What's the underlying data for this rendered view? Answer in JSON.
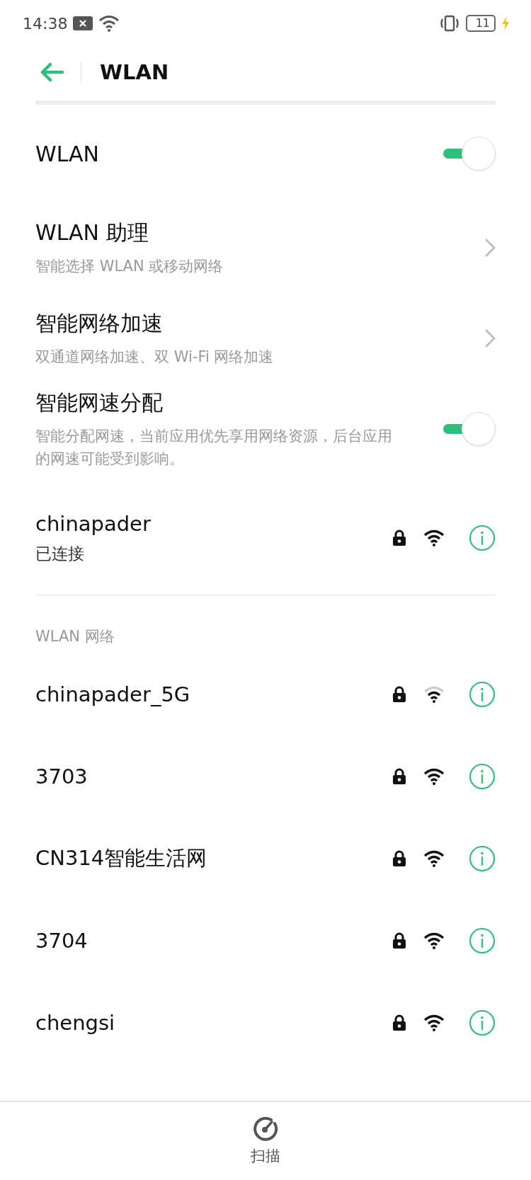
{
  "status_bar": {
    "time": "14:38",
    "battery": "11"
  },
  "header": {
    "title": "WLAN"
  },
  "settings": [
    {
      "kind": "toggle",
      "title": "WLAN",
      "on": true
    },
    {
      "kind": "link",
      "title": "WLAN 助理",
      "subtitle": "智能选择 WLAN 或移动网络"
    },
    {
      "kind": "link",
      "title": "智能网络加速",
      "subtitle": "双通道网络加速、双 Wi-Fi 网络加速"
    },
    {
      "kind": "toggle",
      "title": "智能网速分配",
      "subtitle": "智能分配网速，当前应用优先享用网络资源，后台应用的网速可能受到影响。",
      "on": true
    }
  ],
  "connected": {
    "name": "chinapader",
    "status": "已连接",
    "locked": true,
    "weak": false
  },
  "section_label": "WLAN 网络",
  "networks": [
    {
      "name": "chinapader_5G",
      "locked": true,
      "weak": true
    },
    {
      "name": "3703",
      "locked": true,
      "weak": false
    },
    {
      "name": "CN314智能生活网",
      "locked": true,
      "weak": false
    },
    {
      "name": "3704",
      "locked": true,
      "weak": false
    },
    {
      "name": "chengsi",
      "locked": true,
      "weak": false
    }
  ],
  "bottom_bar": {
    "scan_label": "扫描"
  }
}
